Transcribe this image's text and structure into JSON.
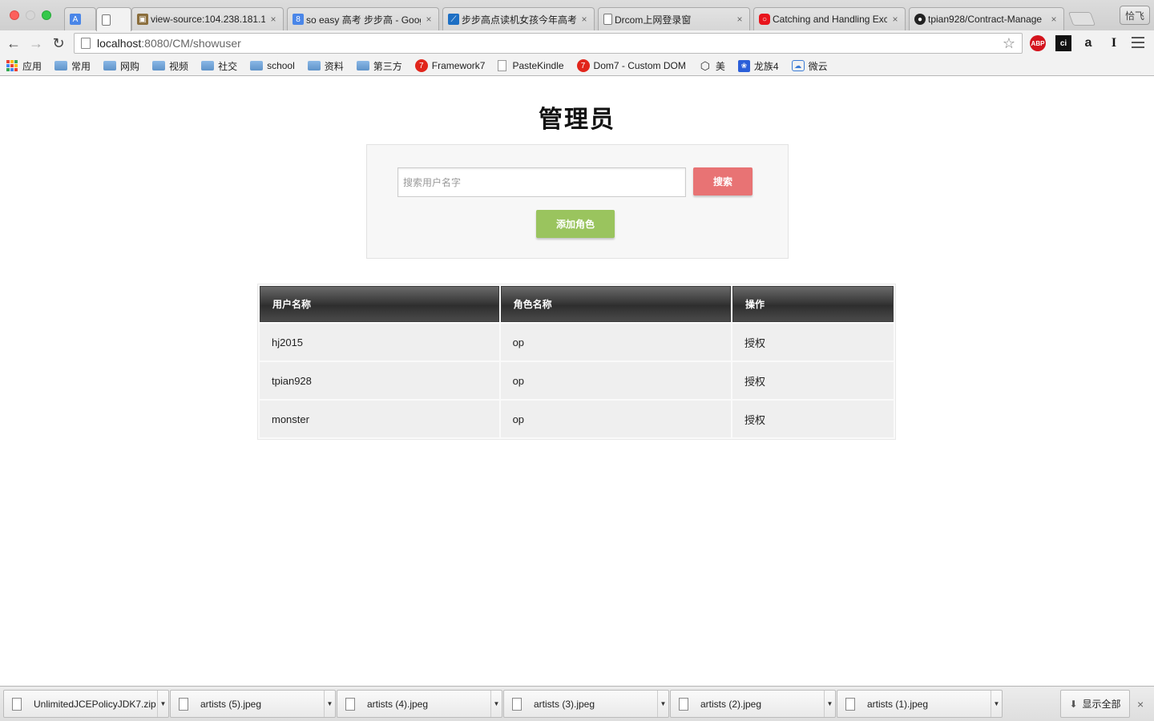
{
  "browser": {
    "tabs": [
      {
        "title": "",
        "active": false,
        "icon": "translate-icon"
      },
      {
        "title": "",
        "active": true,
        "icon": "page-icon"
      },
      {
        "title": "view-source:104.238.181.1",
        "active": false,
        "icon": "image-icon"
      },
      {
        "title": "so easy 高考 步步高 - Goog",
        "active": false,
        "icon": "google-icon"
      },
      {
        "title": "步步高点读机女孩今年高考?",
        "active": false,
        "icon": "site-icon"
      },
      {
        "title": "Drcom上网登录窗",
        "active": false,
        "icon": "page-icon"
      },
      {
        "title": "Catching and Handling Exc",
        "active": false,
        "icon": "oracle-icon"
      },
      {
        "title": "tpian928/Contract-Manage",
        "active": false,
        "icon": "github-icon"
      }
    ],
    "profile_label": "恰飞",
    "url_host": "localhost",
    "url_path": ":8080/CM/showuser",
    "bookmarks": [
      {
        "label": "应用",
        "icon": "apps-icon"
      },
      {
        "label": "常用",
        "icon": "folder-icon"
      },
      {
        "label": "网购",
        "icon": "folder-icon"
      },
      {
        "label": "视频",
        "icon": "folder-icon"
      },
      {
        "label": "社交",
        "icon": "folder-icon"
      },
      {
        "label": "school",
        "icon": "folder-icon"
      },
      {
        "label": "资料",
        "icon": "folder-icon"
      },
      {
        "label": "第三方",
        "icon": "folder-icon"
      },
      {
        "label": "Framework7",
        "icon": "framework7-icon"
      },
      {
        "label": "PasteKindle",
        "icon": "page-icon"
      },
      {
        "label": "Dom7 - Custom DOM",
        "icon": "framework7-icon"
      },
      {
        "label": "美",
        "icon": "codepen-icon"
      },
      {
        "label": "龙族4",
        "icon": "baidu-icon"
      },
      {
        "label": "微云",
        "icon": "cloud-icon"
      }
    ]
  },
  "page": {
    "title": "管理员",
    "search": {
      "placeholder": "搜索用户名字",
      "value": "",
      "button_label": "搜索"
    },
    "add_button_label": "添加角色",
    "table": {
      "headers": [
        "用户名称",
        "角色名称",
        "操作"
      ],
      "rows": [
        {
          "username": "hj2015",
          "role": "op",
          "action": "授权"
        },
        {
          "username": "tpian928",
          "role": "op",
          "action": "授权"
        },
        {
          "username": "monster",
          "role": "op",
          "action": "授权"
        }
      ]
    },
    "colors": {
      "search_button": "#e87374",
      "add_button": "#9ac45e",
      "table_header": "#3a3a3a"
    }
  },
  "downloads": {
    "items": [
      {
        "name": "UnlimitedJCEPolicyJDK7.zip"
      },
      {
        "name": "artists (5).jpeg"
      },
      {
        "name": "artists (4).jpeg"
      },
      {
        "name": "artists (3).jpeg"
      },
      {
        "name": "artists (2).jpeg"
      },
      {
        "name": "artists (1).jpeg"
      }
    ],
    "show_all_label": "显示全部"
  }
}
